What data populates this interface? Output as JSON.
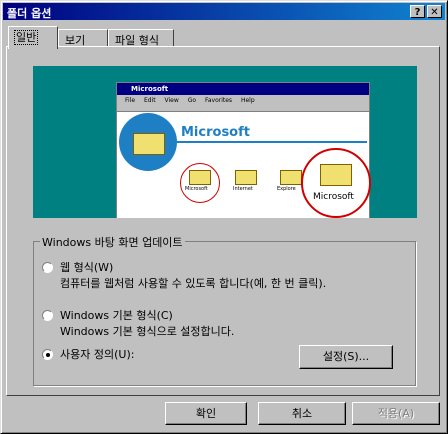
{
  "window": {
    "title": "폴더 옵션",
    "help_label": "?",
    "close_label": "✕"
  },
  "tabs": [
    {
      "label": "일반"
    },
    {
      "label": "보기"
    },
    {
      "label": "파일 형식"
    }
  ],
  "preview": {
    "window_title": "Microsoft",
    "menu": [
      "File",
      "Edit",
      "View",
      "Go",
      "Favorites",
      "Help"
    ],
    "heading": "Microsoft",
    "items": [
      "Microsoft",
      "Internet",
      "Explore"
    ],
    "zoom_label": "Microsoft"
  },
  "group": {
    "legend": "Windows 바탕 화면 업데이트",
    "options": [
      {
        "label": "웹 형식(W)",
        "desc": "컴퓨터를 웹처럼 사용할 수 있도록 합니다(예, 한 번 클릭).",
        "selected": false
      },
      {
        "label": "Windows 기본 형식(C)",
        "desc": "Windows 기본 형식으로 설정합니다.",
        "selected": false
      },
      {
        "label": "사용자 정의(U):",
        "desc": "",
        "selected": true
      }
    ],
    "settings_button": "설정(S)..."
  },
  "buttons": {
    "ok": "확인",
    "cancel": "취소",
    "apply": "적용(A)"
  },
  "colors": {
    "desktop": "#008080",
    "title": "#000080",
    "accent": "#1f7fc4",
    "highlight": "#d00000"
  }
}
